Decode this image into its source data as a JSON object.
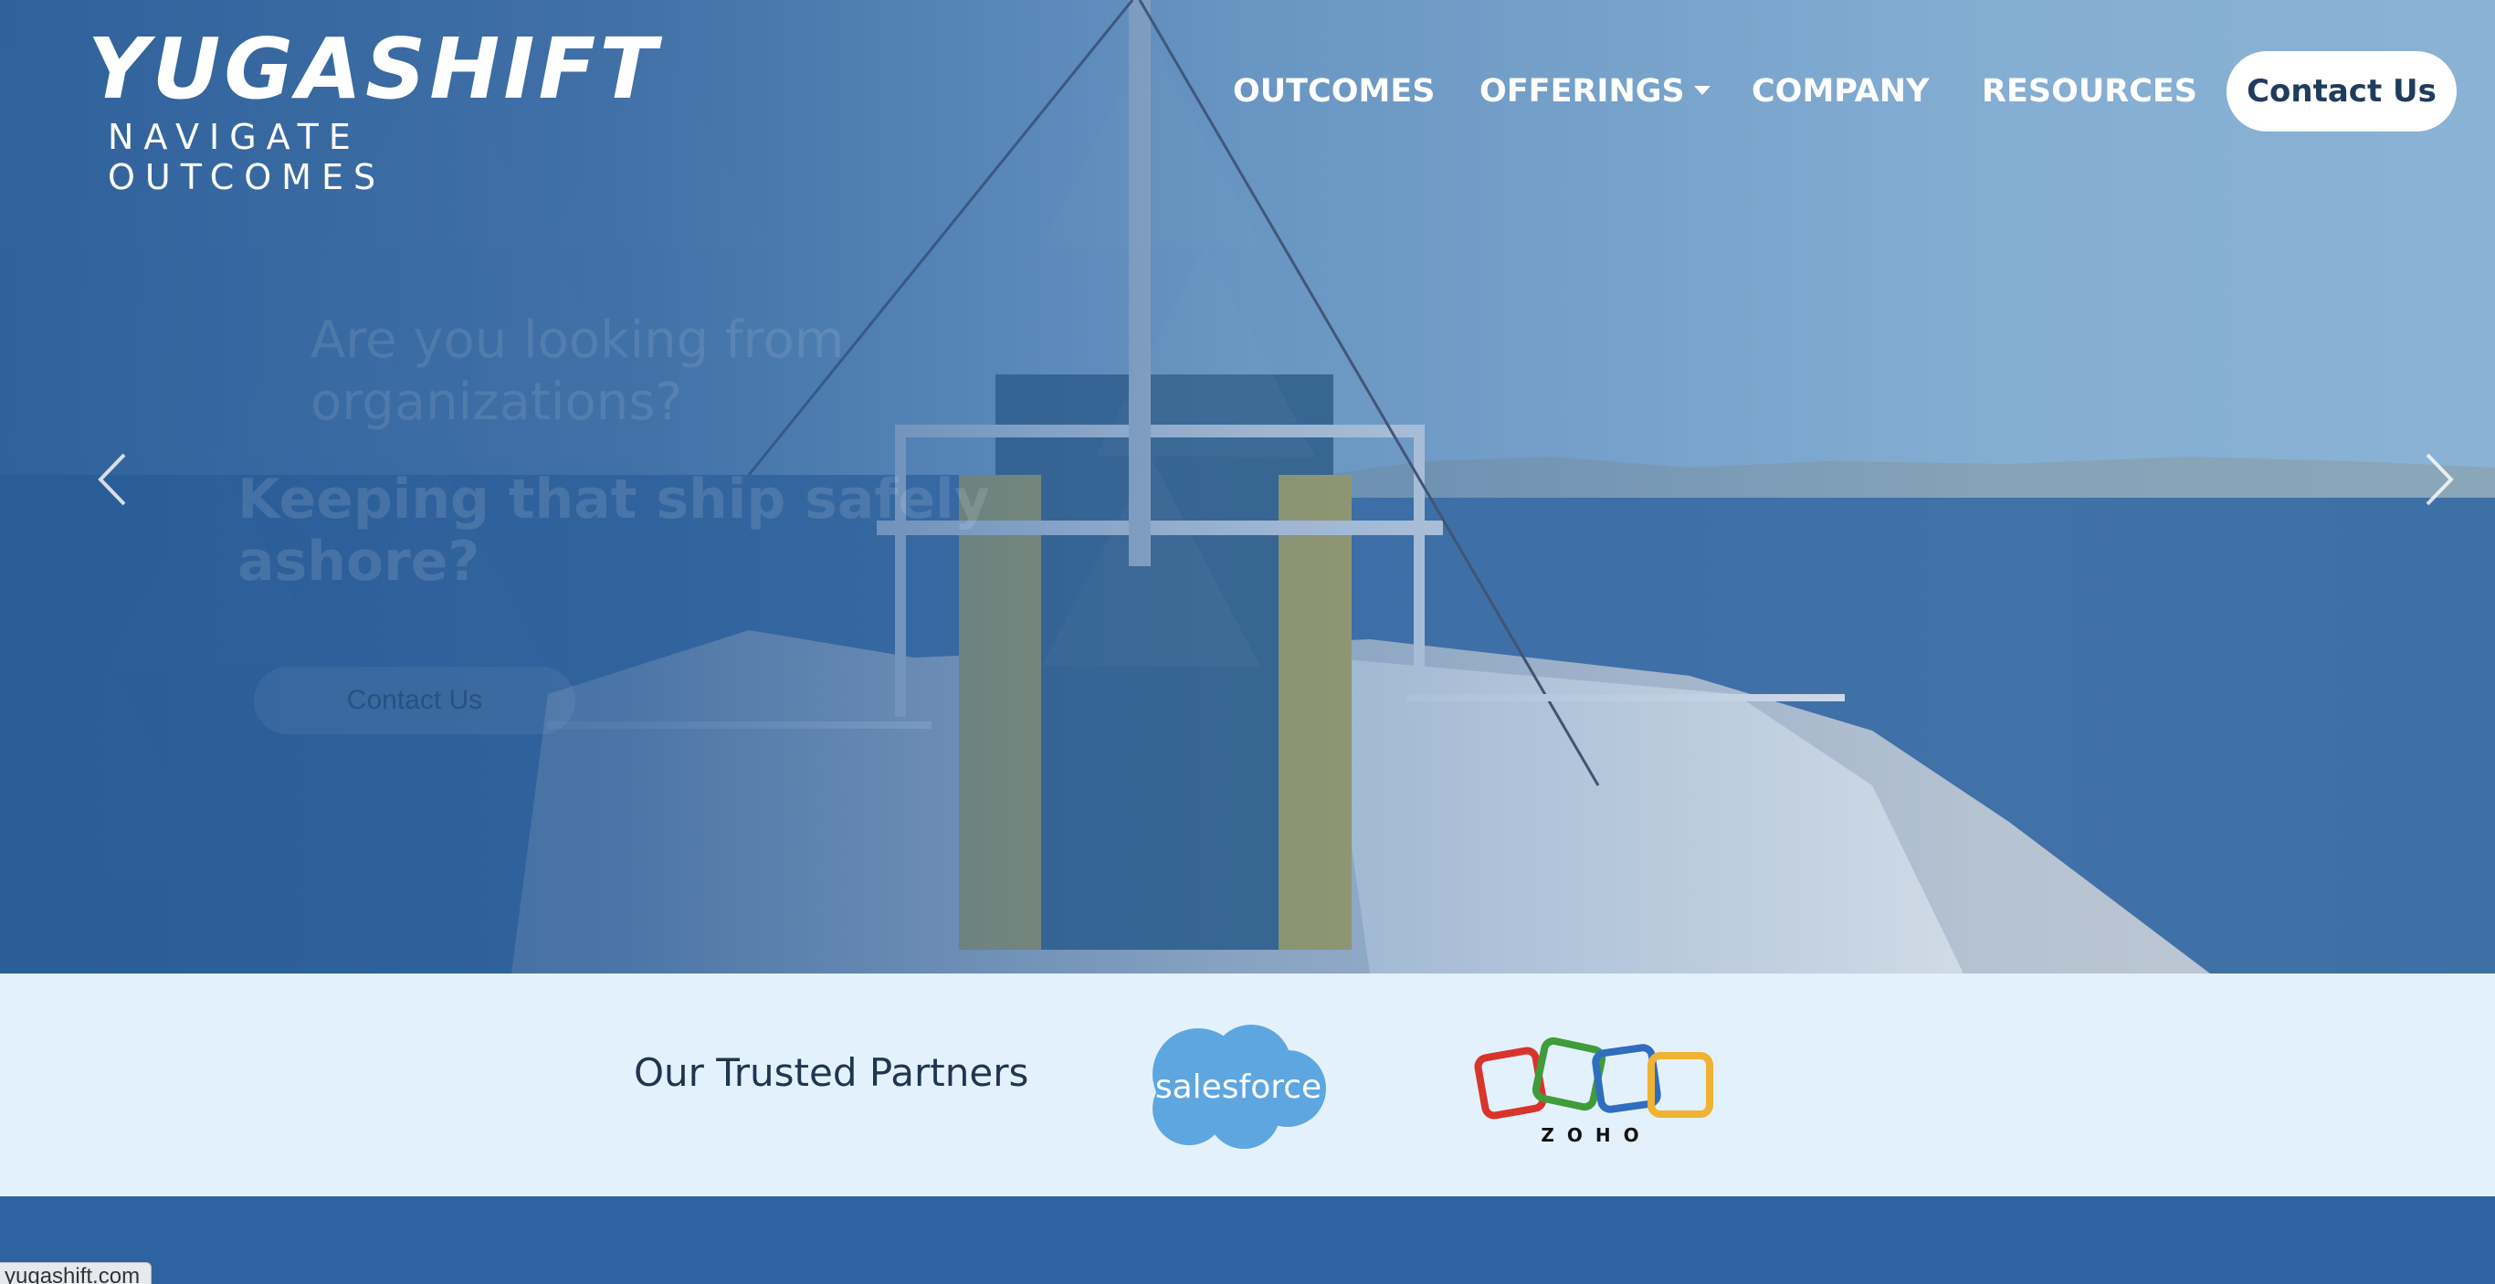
{
  "header": {
    "logo_main": "YUGASHIFT",
    "logo_tagline": "NAVIGATE OUTCOMES",
    "nav": [
      {
        "label": "OUTCOMES"
      },
      {
        "label": "OFFERINGS",
        "has_dropdown": true
      },
      {
        "label": "COMPANY"
      },
      {
        "label": "RESOURCES"
      }
    ],
    "contact_label": "Contact Us"
  },
  "hero": {
    "line1": "Are you looking from",
    "line2": "organizations?",
    "strong1": "Keeping that ship safely",
    "strong2": "ashore?",
    "cta_label": "Contact Us",
    "prev_icon": "chevron-left-icon",
    "next_icon": "chevron-right-icon"
  },
  "partners": {
    "title": "Our Trusted Partners",
    "salesforce_label": "salesforce",
    "zoho_label": "ZOHO",
    "colors": {
      "salesforce": "#5ea6e0",
      "zoho_red": "#d9342b",
      "zoho_green": "#3f9c3a",
      "zoho_blue": "#2f6dbf",
      "zoho_yellow": "#f0b232"
    }
  },
  "status_bar": {
    "url": "yugashift.com"
  },
  "colors": {
    "hero_blue": "#2d5f9b",
    "partners_bg": "#e3f1fc",
    "bottom_bg": "#2e62a0"
  }
}
